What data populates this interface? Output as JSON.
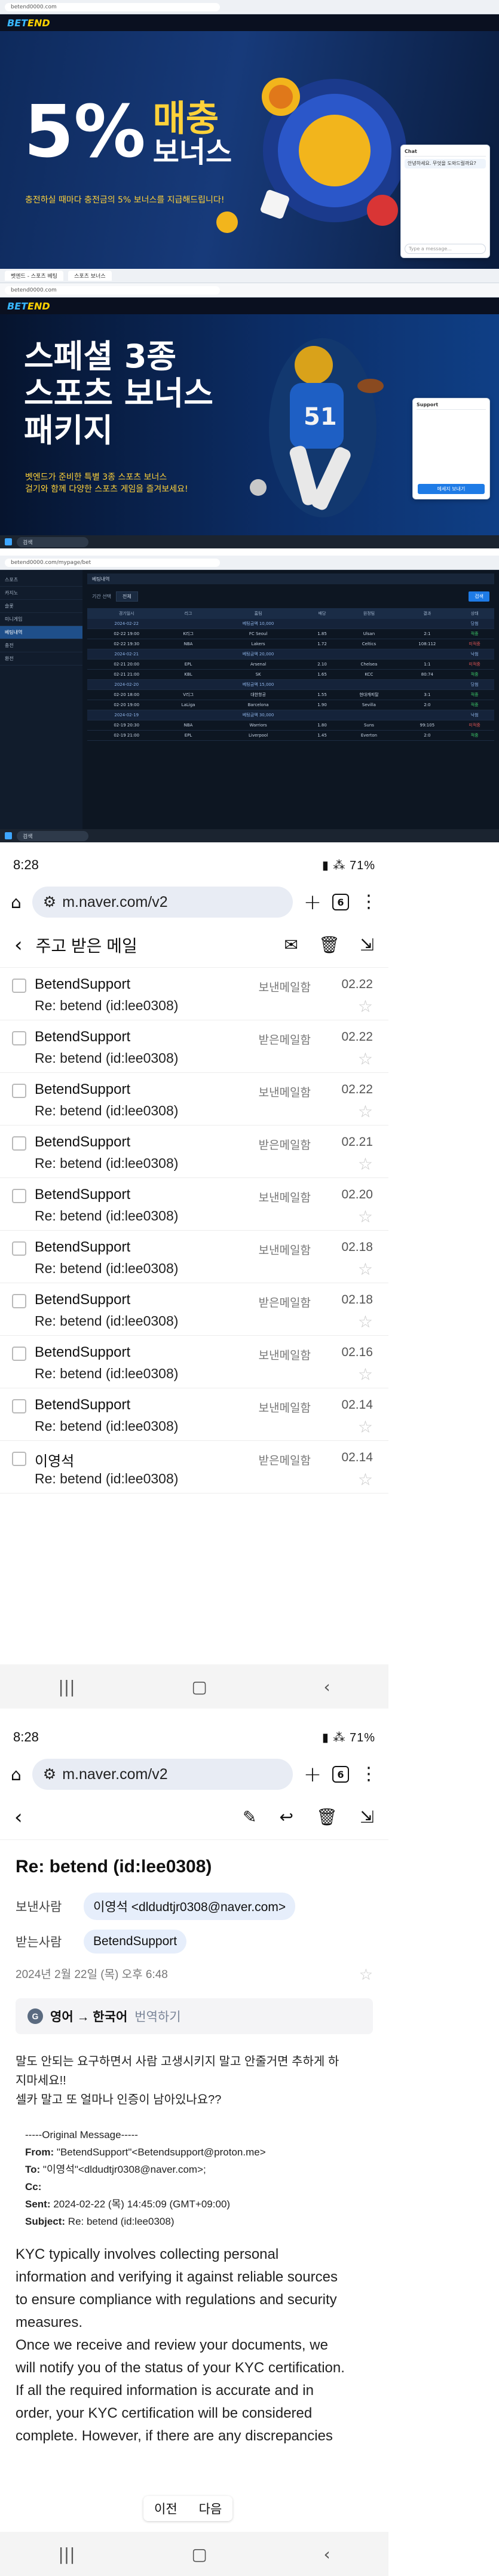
{
  "screen1": {
    "url": "betend0000.com",
    "logo_a": "BET",
    "logo_b": "END",
    "promo_big": "5%",
    "promo_title_line1": "매충",
    "promo_title_line2": "보너스",
    "promo_sub": "충전하실 때마다 충전금의 5% 보너스를 지급해드립니다!",
    "chat_title": "Chat",
    "chat_msg": "안녕하세요. 무엇을 도와드릴까요?",
    "chat_input": "Type a message..."
  },
  "screen2": {
    "tab1": "벳엔드 - 스포츠 베팅",
    "tab2": "스포츠 보너스",
    "url": "betend0000.com",
    "promo_line1": "스페셜 3종",
    "promo_line2": "스포츠 보너스",
    "promo_line3": "패키지",
    "promo_sub1": "벳엔드가 준비한 특별 3종 스포츠 보너스",
    "promo_sub2": "걸기와 함께 다양한 스포츠 게임을 즐겨보세요!",
    "chat_title": "Support",
    "chat_button": "메세지 보내기",
    "search": "검색"
  },
  "screen3": {
    "url": "betend0000.com/mypage/bet",
    "sidebar": [
      "스포츠",
      "카지노",
      "슬롯",
      "미니게임",
      "베팅내역",
      "충전",
      "환전"
    ],
    "section": "베팅내역",
    "filter_label": "기간 선택",
    "filter_value": "전체",
    "search_button": "검색",
    "columns": [
      "경기일시",
      "리그",
      "홈팀",
      "배당",
      "원정팀",
      "결과",
      "상태"
    ],
    "rows": [
      {
        "grp": true,
        "c": [
          "2024-02-22",
          "",
          "베팅금액 10,000",
          "",
          "",
          "",
          "당첨"
        ]
      },
      {
        "grp": false,
        "c": [
          "02-22 19:00",
          "K리그",
          "FC Seoul",
          "1.85",
          "Ulsan",
          "2:1",
          "적중"
        ]
      },
      {
        "grp": false,
        "c": [
          "02-22 19:30",
          "NBA",
          "Lakers",
          "1.72",
          "Celtics",
          "108:112",
          "미적중"
        ]
      },
      {
        "grp": true,
        "c": [
          "2024-02-21",
          "",
          "베팅금액 20,000",
          "",
          "",
          "",
          "낙첨"
        ]
      },
      {
        "grp": false,
        "c": [
          "02-21 20:00",
          "EPL",
          "Arsenal",
          "2.10",
          "Chelsea",
          "1:1",
          "미적중"
        ]
      },
      {
        "grp": false,
        "c": [
          "02-21 21:00",
          "KBL",
          "SK",
          "1.65",
          "KCC",
          "80:74",
          "적중"
        ]
      },
      {
        "grp": true,
        "c": [
          "2024-02-20",
          "",
          "베팅금액 15,000",
          "",
          "",
          "",
          "당첨"
        ]
      },
      {
        "grp": false,
        "c": [
          "02-20 18:00",
          "V리그",
          "대한항공",
          "1.55",
          "현대캐피탈",
          "3:1",
          "적중"
        ]
      },
      {
        "grp": false,
        "c": [
          "02-20 19:00",
          "LaLiga",
          "Barcelona",
          "1.90",
          "Sevilla",
          "2:0",
          "적중"
        ]
      },
      {
        "grp": true,
        "c": [
          "2024-02-19",
          "",
          "베팅금액 30,000",
          "",
          "",
          "",
          "낙첨"
        ]
      },
      {
        "grp": false,
        "c": [
          "02-19 20:30",
          "NBA",
          "Warriors",
          "1.80",
          "Suns",
          "99:105",
          "미적중"
        ]
      },
      {
        "grp": false,
        "c": [
          "02-19 21:00",
          "EPL",
          "Liverpool",
          "1.45",
          "Everton",
          "2:0",
          "적중"
        ]
      }
    ]
  },
  "phone1": {
    "time": "8:28",
    "battery": "71%",
    "url": "m.naver.com/v2",
    "tab_count": "6",
    "folder_title": "주고 받은 메일",
    "rows": [
      {
        "from": "BetendSupport",
        "subject": "Re: betend (id:lee0308)",
        "box": "보낸메일함",
        "date": "02.22"
      },
      {
        "from": "BetendSupport",
        "subject": "Re: betend (id:lee0308)",
        "box": "받은메일함",
        "date": "02.22"
      },
      {
        "from": "BetendSupport",
        "subject": "Re: betend (id:lee0308)",
        "box": "보낸메일함",
        "date": "02.22"
      },
      {
        "from": "BetendSupport",
        "subject": "Re: betend (id:lee0308)",
        "box": "받은메일함",
        "date": "02.21"
      },
      {
        "from": "BetendSupport",
        "subject": "Re: betend (id:lee0308)",
        "box": "보낸메일함",
        "date": "02.20"
      },
      {
        "from": "BetendSupport",
        "subject": "Re: betend (id:lee0308)",
        "box": "보낸메일함",
        "date": "02.18"
      },
      {
        "from": "BetendSupport",
        "subject": "Re: betend (id:lee0308)",
        "box": "받은메일함",
        "date": "02.18"
      },
      {
        "from": "BetendSupport",
        "subject": "Re: betend (id:lee0308)",
        "box": "보낸메일함",
        "date": "02.16"
      },
      {
        "from": "BetendSupport",
        "subject": "Re: betend (id:lee0308)",
        "box": "보낸메일함",
        "date": "02.14"
      },
      {
        "from": "이영석",
        "subject": "Re: betend (id:lee0308)",
        "box": "받은메일함",
        "date": "02.14"
      }
    ]
  },
  "phone2": {
    "time": "8:28",
    "battery": "71%",
    "url": "m.naver.com/v2",
    "tab_count": "6",
    "subject": "Re: betend (id:lee0308)",
    "sender_label": "보낸사람",
    "sender": "이영석 <dldudtjr0308@naver.com>",
    "recipient_label": "받는사람",
    "recipient": "BetendSupport",
    "date": "2024년 2월 22일 (목) 오후 6:48",
    "translate_from": "영어 → 한국어",
    "translate_link": "번역하기",
    "body_lines": [
      "말도 안되는 요구하면서 사람 고생시키지 말고 안줄거면 추하게 하",
      "지마세요!!",
      "셀카 말고 또 얼마나 인증이 남아있나요??"
    ],
    "orig_header": "-----Original Message-----",
    "orig_from_label": "From:",
    "orig_from": "\"BetendSupport\"<Betendsupport@proton.me>",
    "orig_to_label": "To:",
    "orig_to": "\"이영석\"<dldudtjr0308@naver.com>;",
    "orig_cc_label": "Cc:",
    "orig_sent_label": "Sent:",
    "orig_sent": "2024-02-22 (목) 14:45:09 (GMT+09:00)",
    "orig_subject_label": "Subject:",
    "orig_subject": "Re: betend (id:lee0308)",
    "kyc_lines": [
      "KYC  typically involves collecting personal",
      "information and verifying it against reliable sources",
      "to ensure compliance with regulations and security",
      "measures.",
      "Once we receive and review your documents, we",
      "will notify you of the status of your KYC certification.",
      "If all the required information is accurate and in",
      "order, your KYC certification will be considered",
      "complete. However, if there are any discrepancies"
    ],
    "prev": "이전",
    "next": "다음"
  }
}
